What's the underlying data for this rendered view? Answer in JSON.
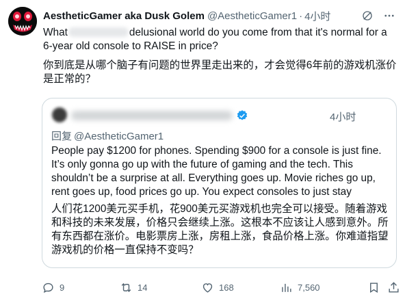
{
  "author": {
    "display_name": "AestheticGamer aka Dusk Golem",
    "handle": "@AestheticGamer1",
    "separator": "·",
    "time": "4小时"
  },
  "tweet": {
    "text_en_before": "What",
    "text_en_after": "delusional world do you come from that it's normal for a 6-year old console to RAISE in price?",
    "text_zh": "你到底是从哪个脑子有问题的世界里走出来的，才会觉得6年前的游戏机涨价是正常的？"
  },
  "quote": {
    "time": "4小时",
    "reply_prefix": "回复",
    "reply_handle": "@AestheticGamer1",
    "text_en": "People pay $1200 for phones. Spending $900 for a console is just fine. It’s only gonna go up with the future of gaming and the tech. This shouldn’t be a surprise at all. Everything goes up. Movie riches go up, rent goes up, food prices go up. You expect consoles to just stay",
    "text_zh": "人们花1200美元买手机，花900美元买游戏机也完全可以接受。随着游戏和科技的未来发展，价格只会继续上涨。这根本不应该让人感到意外。所有东西都在涨价。电影票房上涨，房租上涨，食品价格上涨。你难道指望游戏机的价格一直保持不变吗？"
  },
  "actions": {
    "replies": "9",
    "reposts": "14",
    "likes": "168",
    "views": "7,560"
  },
  "colors": {
    "text": "#0f1419",
    "muted": "#536471",
    "border": "#cfd9de",
    "verified": "#1d9bf0"
  }
}
